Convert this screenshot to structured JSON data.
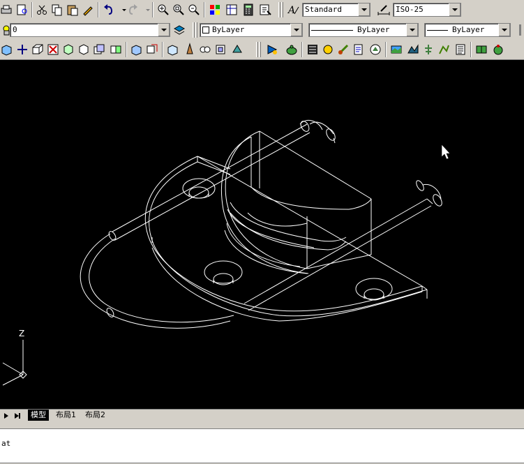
{
  "toolbar": {
    "text_style": "Standard",
    "dim_style": "ISO-25",
    "layer": "0",
    "color": "ByLayer",
    "linetype": "ByLayer",
    "lineweight": "ByLayer"
  },
  "layout_tabs": [
    "模型",
    "布局1",
    "布局2"
  ],
  "ucs_label": "Z",
  "command_line": "at",
  "colors": {
    "canvas": "#000000",
    "model_lines": "#ffffff",
    "chrome": "#d4d0c8"
  }
}
